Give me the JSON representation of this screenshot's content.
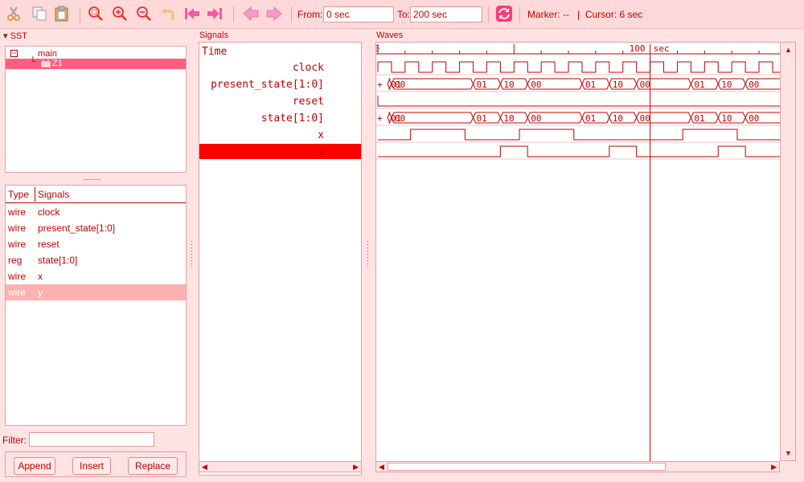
{
  "toolbar": {
    "from_label": "From:",
    "from_value": "0 sec",
    "to_label": "To:",
    "to_value": "200 sec",
    "marker_label": "Marker: --",
    "separator": "|",
    "cursor_label": "Cursor: 6 sec",
    "icons": [
      "cut-icon",
      "copy-icon",
      "paste-icon",
      "zoom-fit-icon",
      "zoom-in-icon",
      "zoom-out-icon",
      "undo-icon",
      "first-icon",
      "last-icon",
      "prev-icon",
      "next-icon",
      "reload-icon"
    ]
  },
  "sst": {
    "title": "SST",
    "tree": [
      {
        "label": "main",
        "expanded": true
      },
      {
        "label": "Z1",
        "selected": true
      }
    ],
    "table_headers": [
      "Type",
      "Signals"
    ],
    "rows": [
      {
        "type": "wire",
        "name": "clock"
      },
      {
        "type": "wire",
        "name": "present_state[1:0]"
      },
      {
        "type": "wire",
        "name": "reset"
      },
      {
        "type": "reg",
        "name": "state[1:0]"
      },
      {
        "type": "wire",
        "name": "x"
      },
      {
        "type": "wire",
        "name": "y",
        "selected": true
      }
    ],
    "filter_label": "Filter:",
    "filter_value": "",
    "buttons": [
      "Append",
      "Insert",
      "Replace"
    ]
  },
  "signals": {
    "title": "Signals",
    "time_label": "Time",
    "names": [
      "clock",
      "present_state[1:0]",
      "reset",
      "state[1:0]",
      "x",
      "y"
    ],
    "selected": "y"
  },
  "waves": {
    "title": "Waves",
    "ruler_start": "0",
    "ruler_mark": "100",
    "ruler_unit": "sec",
    "bus_prefix": "+",
    "present_state_values": [
      "01",
      "00",
      "01",
      "10",
      "00",
      "01",
      "10",
      "00",
      "01",
      "10",
      "00"
    ],
    "state_values": [
      "01",
      "00",
      "01",
      "10",
      "00",
      "01",
      "10",
      "00",
      "01",
      "10",
      "00"
    ],
    "marker_time": 100,
    "colors": {
      "wave": "#c00000",
      "highlight": "#ff0000",
      "panel": "#ffe3e3"
    }
  }
}
